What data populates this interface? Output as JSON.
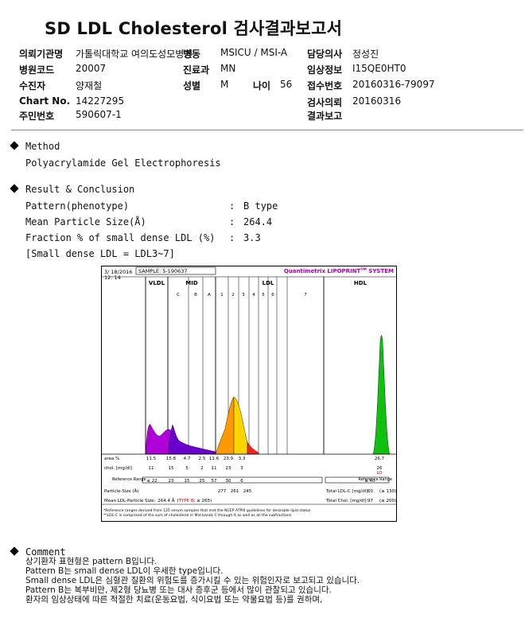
{
  "title": "SD LDL Cholesterol 검사결과보고서",
  "header": {
    "r1": [
      {
        "label": "의뢰기관명",
        "value": "가톨릭대학교 여의도성모병원"
      },
      {
        "label": "병동",
        "value": "MSICU / MSI-A"
      },
      {
        "label": "담당의사",
        "value": "정성진"
      }
    ],
    "r2": [
      {
        "label": "병원코드",
        "value": "20007"
      },
      {
        "label": "진료과",
        "value": "MN"
      },
      {
        "label": "임상정보",
        "value": "I15QE0HT0"
      }
    ],
    "r3": [
      {
        "label": "수진자",
        "value": "양재철"
      },
      {
        "label": "성별",
        "value": "M"
      },
      {
        "label": "나이",
        "value": "56"
      },
      {
        "label": "접수번호",
        "value": "20160316-79097"
      }
    ],
    "r4": [
      {
        "label": "Chart No.",
        "value": "14227295"
      },
      {
        "label": "검사의뢰",
        "value": "20160316"
      }
    ],
    "r5": [
      {
        "label": "주민번호",
        "value": "590607-1"
      },
      {
        "label": "결과보고",
        "value": ""
      }
    ]
  },
  "method": {
    "heading": "Method",
    "text": "Polyacrylamide Gel Electrophoresis"
  },
  "result": {
    "heading": "Result & Conclusion",
    "rows": [
      {
        "label": "Pattern(phenotype)",
        "colon": ":",
        "value": "B type"
      },
      {
        "label": "Mean Particle Size(Å)",
        "colon": ":",
        "value": "264.4"
      },
      {
        "label": "Fraction % of small dense LDL (%)",
        "colon": ":",
        "value": "3.3"
      }
    ],
    "note": "[Small dense LDL = LDL3~7]"
  },
  "chart_data": {
    "type": "area",
    "date": "3/ 18/2016",
    "time": "12: 14",
    "sample": "SAMPLE:   5-190637",
    "brand": "Quantimetrix LIPOPRINT",
    "brand_sup": "TM",
    "brand_tail": " SYSTEM",
    "groups": [
      "VLDL",
      "MID",
      "LDL",
      "HDL"
    ],
    "bands": [
      "C",
      "B",
      "A",
      "1",
      "2",
      "3",
      "4",
      "5",
      "6",
      "7"
    ],
    "area_label": "area %",
    "area_values": [
      "11.5",
      "15.8",
      "4.7",
      "2.5",
      "11.6",
      "23.9",
      "3.3",
      "26.7"
    ],
    "chol_label": "chol. [mg/dl]",
    "chol_values": [
      "11",
      "15",
      "5",
      "2",
      "11",
      "23",
      "3",
      "26"
    ],
    "hdl_flag": "LO",
    "ref_label": "Reference\nRange",
    "ref_values": [
      "≤ 22",
      "23",
      "15",
      "25",
      "57",
      "30",
      "6",
      "≥ 40"
    ],
    "ref_label_r": "Reference\nRange",
    "ps_label": "Particle-Size (Å)",
    "ps_values": [
      "277",
      "261",
      "245"
    ],
    "ldlc_label": "Total LDL-C [mg/dl]:",
    "ldlc_value": "60",
    "ldlc_ref": "(≤ 130)",
    "mean_label": "Mean LDL-Particle Size:",
    "mean_value": "264.4 Å",
    "mean_type_pre": "(",
    "mean_type": "TYPE B",
    "mean_type_post": "; ≥ 265)",
    "tchol_label": "Total Chol. [mg/dl]:",
    "tchol_value": "97",
    "tchol_ref": "(≤ 200)",
    "footnote1": "*Reference ranges derived from 125 serum samples that met the NCEP ATPIII guidelines for desirable lipid status",
    "footnote2": "**LDL-C is comprised of the sum of cholesterol in Mid bands C through A as well as all the subfractions",
    "colors": {
      "vldl": "#b000d8",
      "mid": "#6a00cc",
      "ldl1": "#ff9a00",
      "ldl2": "#ffd400",
      "ldl3": "#ff2020",
      "hdl": "#10c010",
      "brand": "#b000b0",
      "flag": "#d80000"
    }
  },
  "comment": {
    "heading": "Comment",
    "lines": [
      "상기환자 표현형은 pattern B입니다.",
      "Pattern B는 small dense LDL이 우세한 type입니다.",
      "Small dense LDL은 심혈관 질환의 위험도를 증가시킬 수 있는 위험인자로 보고되고 있습니다.",
      "Pattern B는 복부비만, 제2형 당뇨병 또는 대사 증후군 등에서 많이 관찰되고 있습니다.",
      "환자의 임상상태에 따른 적절한 치료(운동요법, 식이요법 또는 약물요법 등)를 권하며,"
    ]
  }
}
